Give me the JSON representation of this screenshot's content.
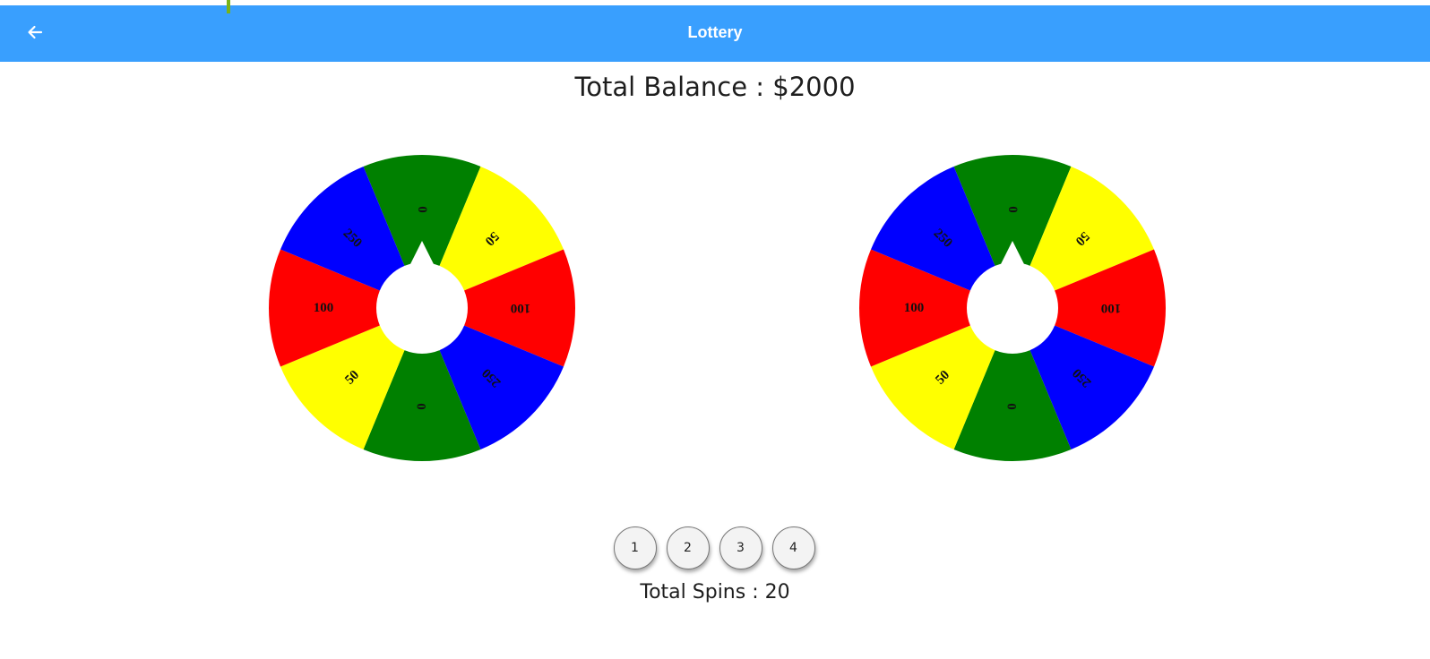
{
  "header": {
    "title": "Lottery",
    "back_icon": "arrow-left-icon",
    "background_color": "#399ffe"
  },
  "balance": {
    "text": "Total Balance : $2000"
  },
  "wheels": [
    {
      "segments": [
        {
          "label": "0",
          "color": "#008000"
        },
        {
          "label": "50",
          "color": "#ffff00"
        },
        {
          "label": "100",
          "color": "#ff0000"
        },
        {
          "label": "250",
          "color": "#0000ff"
        },
        {
          "label": "0",
          "color": "#008000"
        },
        {
          "label": "50",
          "color": "#ffff00"
        },
        {
          "label": "100",
          "color": "#ff0000"
        },
        {
          "label": "250",
          "color": "#0000ff"
        }
      ]
    },
    {
      "segments": [
        {
          "label": "0",
          "color": "#008000"
        },
        {
          "label": "50",
          "color": "#ffff00"
        },
        {
          "label": "100",
          "color": "#ff0000"
        },
        {
          "label": "250",
          "color": "#0000ff"
        },
        {
          "label": "0",
          "color": "#008000"
        },
        {
          "label": "50",
          "color": "#ffff00"
        },
        {
          "label": "100",
          "color": "#ff0000"
        },
        {
          "label": "250",
          "color": "#0000ff"
        }
      ]
    }
  ],
  "spin_options": [
    "1",
    "2",
    "3",
    "4"
  ],
  "total_spins": {
    "text": "Total Spins : 20"
  }
}
